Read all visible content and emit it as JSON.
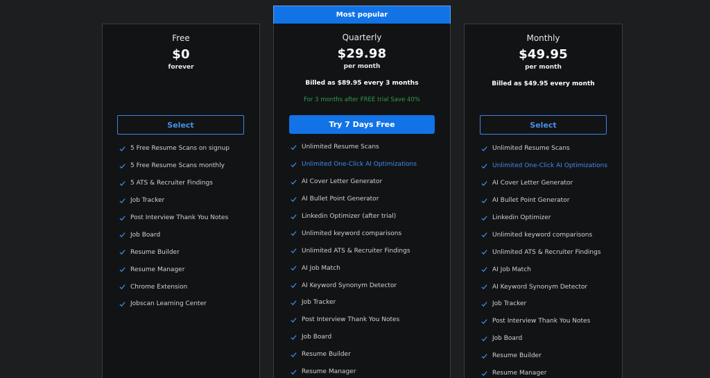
{
  "accent_color": "#1273e6",
  "highlight_color": "#3d8ef0",
  "trial_note_color": "#2e9e4f",
  "plans": {
    "free": {
      "name": "Free",
      "price": "$0",
      "period": "forever",
      "button": "Select",
      "features": [
        {
          "text": "5 Free Resume Scans on signup",
          "highlight": false
        },
        {
          "text": "5 Free Resume Scans monthly",
          "highlight": false
        },
        {
          "text": "5 ATS & Recruiter Findings",
          "highlight": false
        },
        {
          "text": "Job Tracker",
          "highlight": false
        },
        {
          "text": "Post Interview Thank You Notes",
          "highlight": false
        },
        {
          "text": "Job Board",
          "highlight": false
        },
        {
          "text": "Resume Builder",
          "highlight": false
        },
        {
          "text": "Resume Manager",
          "highlight": false
        },
        {
          "text": "Chrome Extension",
          "highlight": false
        },
        {
          "text": "Jobscan Learning Center",
          "highlight": false
        }
      ]
    },
    "quarterly": {
      "badge": "Most popular",
      "name": "Quarterly",
      "price": "$29.98",
      "period": "per month",
      "billed": "Billed as $89.95 every 3 months",
      "trial_note": "For 3 months after FREE trial Save 40%",
      "button": "Try 7 Days Free",
      "features": [
        {
          "text": "Unlimited Resume Scans",
          "highlight": false
        },
        {
          "text": "Unlimited One-Click AI Optimizations",
          "highlight": true
        },
        {
          "text": "AI Cover Letter Generator",
          "highlight": false
        },
        {
          "text": "AI Bullet Point Generator",
          "highlight": false
        },
        {
          "text": "Linkedin Optimizer (after trial)",
          "highlight": false
        },
        {
          "text": "Unlimited keyword comparisons",
          "highlight": false
        },
        {
          "text": "Unlimited ATS & Recruiter Findings",
          "highlight": false
        },
        {
          "text": "AI Job Match",
          "highlight": false
        },
        {
          "text": "AI Keyword Synonym Detector",
          "highlight": false
        },
        {
          "text": "Job Tracker",
          "highlight": false
        },
        {
          "text": "Post Interview Thank You Notes",
          "highlight": false
        },
        {
          "text": "Job Board",
          "highlight": false
        },
        {
          "text": "Resume Builder",
          "highlight": false
        },
        {
          "text": "Resume Manager",
          "highlight": false
        }
      ]
    },
    "monthly": {
      "name": "Monthly",
      "price": "$49.95",
      "period": "per month",
      "billed": "Billed as $49.95 every month",
      "button": "Select",
      "features": [
        {
          "text": "Unlimited Resume Scans",
          "highlight": false
        },
        {
          "text": "Unlimited One-Click AI Optimizations",
          "highlight": true
        },
        {
          "text": "AI Cover Letter Generator",
          "highlight": false
        },
        {
          "text": "AI Bullet Point Generator",
          "highlight": false
        },
        {
          "text": "Linkedin Optimizer",
          "highlight": false
        },
        {
          "text": "Unlimited keyword comparisons",
          "highlight": false
        },
        {
          "text": "Unlimited ATS & Recruiter Findings",
          "highlight": false
        },
        {
          "text": "AI Job Match",
          "highlight": false
        },
        {
          "text": "AI Keyword Synonym Detector",
          "highlight": false
        },
        {
          "text": "Job Tracker",
          "highlight": false
        },
        {
          "text": "Post Interview Thank You Notes",
          "highlight": false
        },
        {
          "text": "Job Board",
          "highlight": false
        },
        {
          "text": "Resume Builder",
          "highlight": false
        },
        {
          "text": "Resume Manager",
          "highlight": false
        }
      ]
    }
  }
}
